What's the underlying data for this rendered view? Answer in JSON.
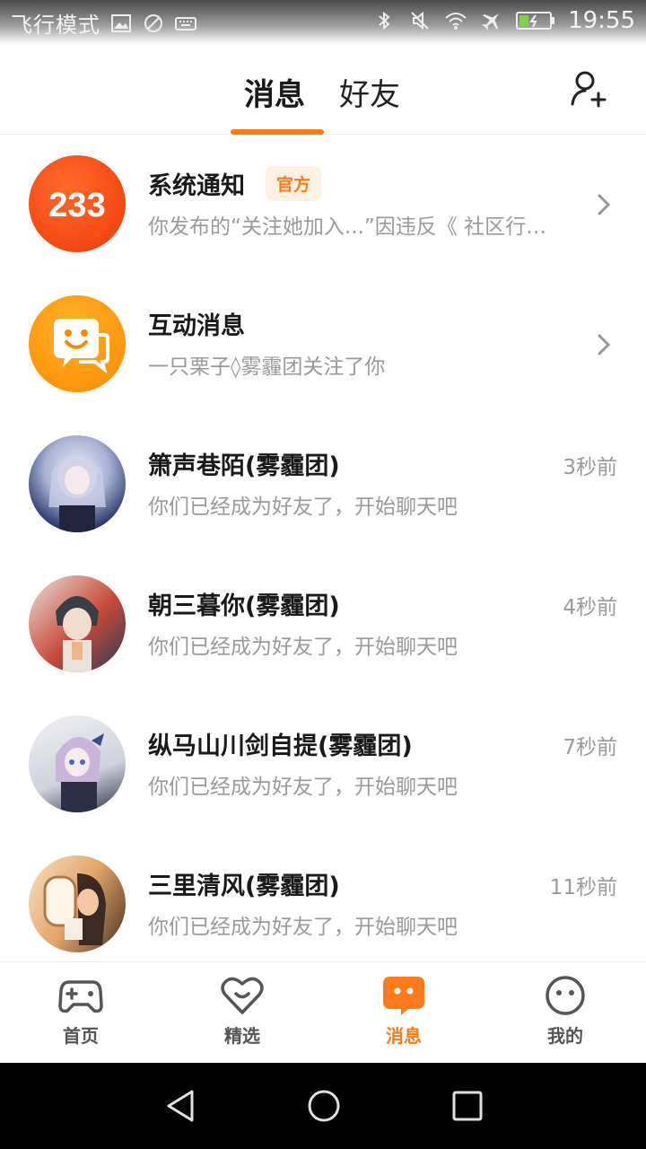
{
  "status_bar": {
    "left_text": "飞行模式",
    "time": "19:55"
  },
  "header": {
    "tabs": [
      {
        "label": "消息",
        "active": true
      },
      {
        "label": "好友",
        "active": false
      }
    ],
    "accent": "#ff7a1a"
  },
  "messages": [
    {
      "name": "系统通知",
      "badge": "官方",
      "preview": "你发布的“关注她加入...”因违反《 社区行为...",
      "time": "",
      "avatar": "233-logo-icon",
      "avatar_text": "233"
    },
    {
      "name": "互动消息",
      "badge": "",
      "preview": "一只栗子◊雾霾团关注了你",
      "time": "",
      "avatar": "chat-bubble-icon"
    },
    {
      "name": "箫声巷陌(雾霾团)",
      "preview": "你们已经成为好友了，开始聊天吧",
      "time": "3秒前",
      "avatar": "anime-avatar"
    },
    {
      "name": "朝三暮你(雾霾团)",
      "preview": "你们已经成为好友了，开始聊天吧",
      "time": "4秒前",
      "avatar": "anime-avatar"
    },
    {
      "name": "纵马山川剑自提(雾霾团)",
      "preview": "你们已经成为好友了，开始聊天吧",
      "time": "7秒前",
      "avatar": "anime-avatar"
    },
    {
      "name": "三里清风(雾霾团)",
      "preview": "你们已经成为好友了，开始聊天吧",
      "time": "11秒前",
      "avatar": "anime-avatar"
    }
  ],
  "bottom_nav": [
    {
      "label": "首页",
      "icon": "gamepad-icon",
      "active": false
    },
    {
      "label": "精选",
      "icon": "heart-icon",
      "active": false
    },
    {
      "label": "消息",
      "icon": "message-icon",
      "active": true
    },
    {
      "label": "我的",
      "icon": "smiley-icon",
      "active": false
    }
  ]
}
